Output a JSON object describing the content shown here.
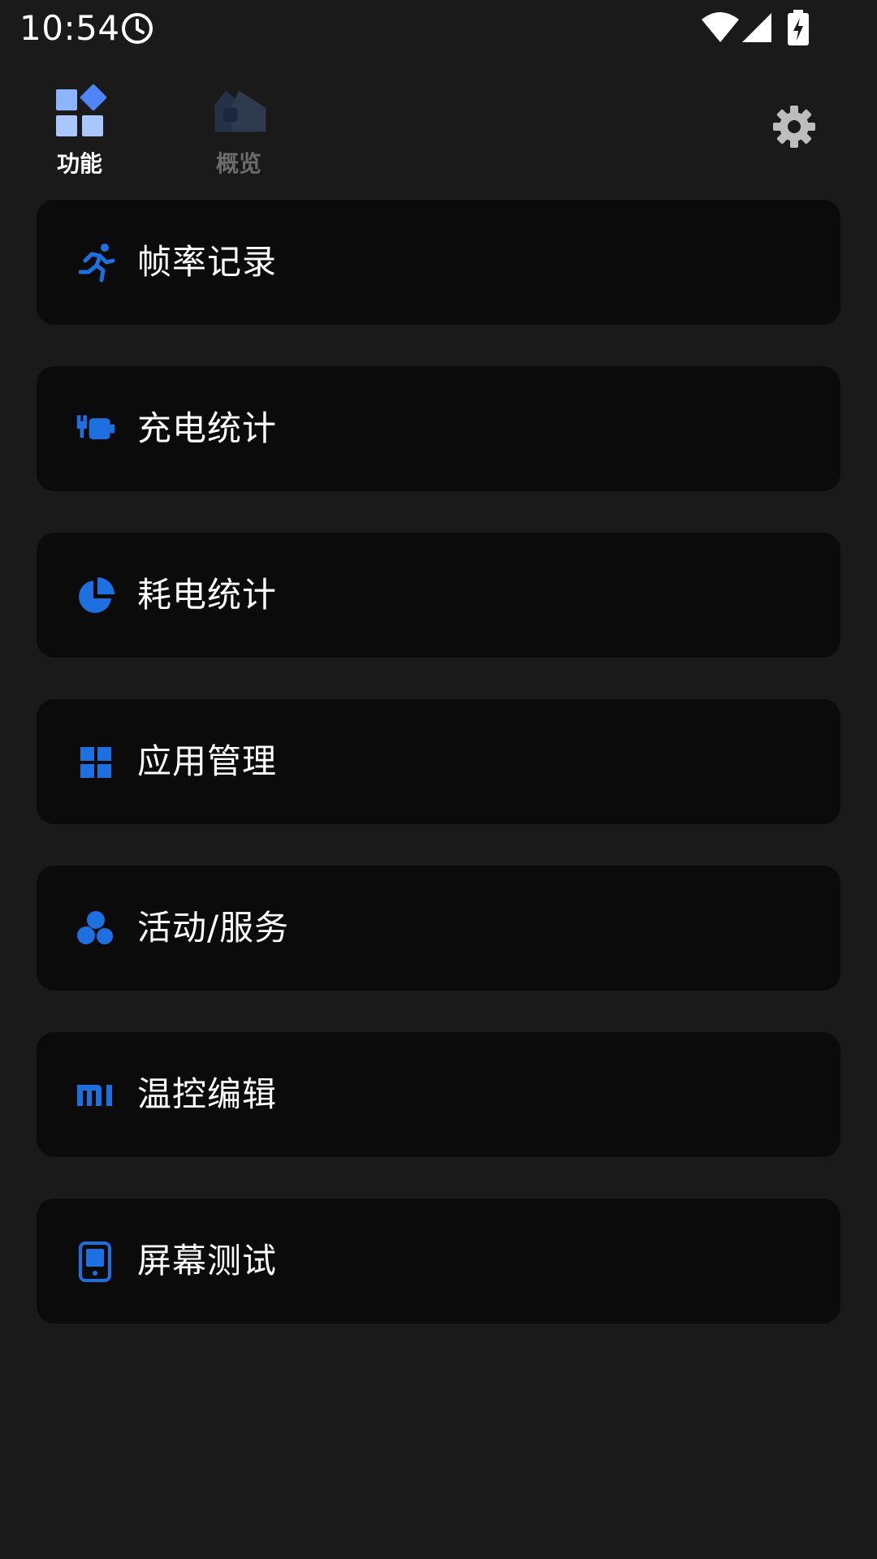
{
  "status_bar": {
    "time": "10:54"
  },
  "tabs": [
    {
      "label": "功能",
      "icon": "features-grid-icon",
      "active": true
    },
    {
      "label": "概览",
      "icon": "overview-home-icon",
      "active": false
    }
  ],
  "settings_icon": "gear-icon",
  "features": [
    {
      "label": "帧率记录",
      "icon": "running-figure-icon"
    },
    {
      "label": "充电统计",
      "icon": "charging-plug-icon"
    },
    {
      "label": "耗电统计",
      "icon": "pie-chart-icon"
    },
    {
      "label": "应用管理",
      "icon": "app-grid-icon"
    },
    {
      "label": "活动/服务",
      "icon": "bubbles-icon"
    },
    {
      "label": "温控编辑",
      "icon": "mi-logo-icon"
    },
    {
      "label": "屏幕测试",
      "icon": "phone-screen-icon"
    }
  ],
  "colors": {
    "background": "#1a1a1a",
    "card": "#0b0b0b",
    "accent": "#1e6fe0",
    "tab_active_icon": "#8db4ff",
    "tab_inactive_icon": "#2e3a4e",
    "inactive_text": "#6b6b6b",
    "settings_icon": "#bdbdbd"
  }
}
